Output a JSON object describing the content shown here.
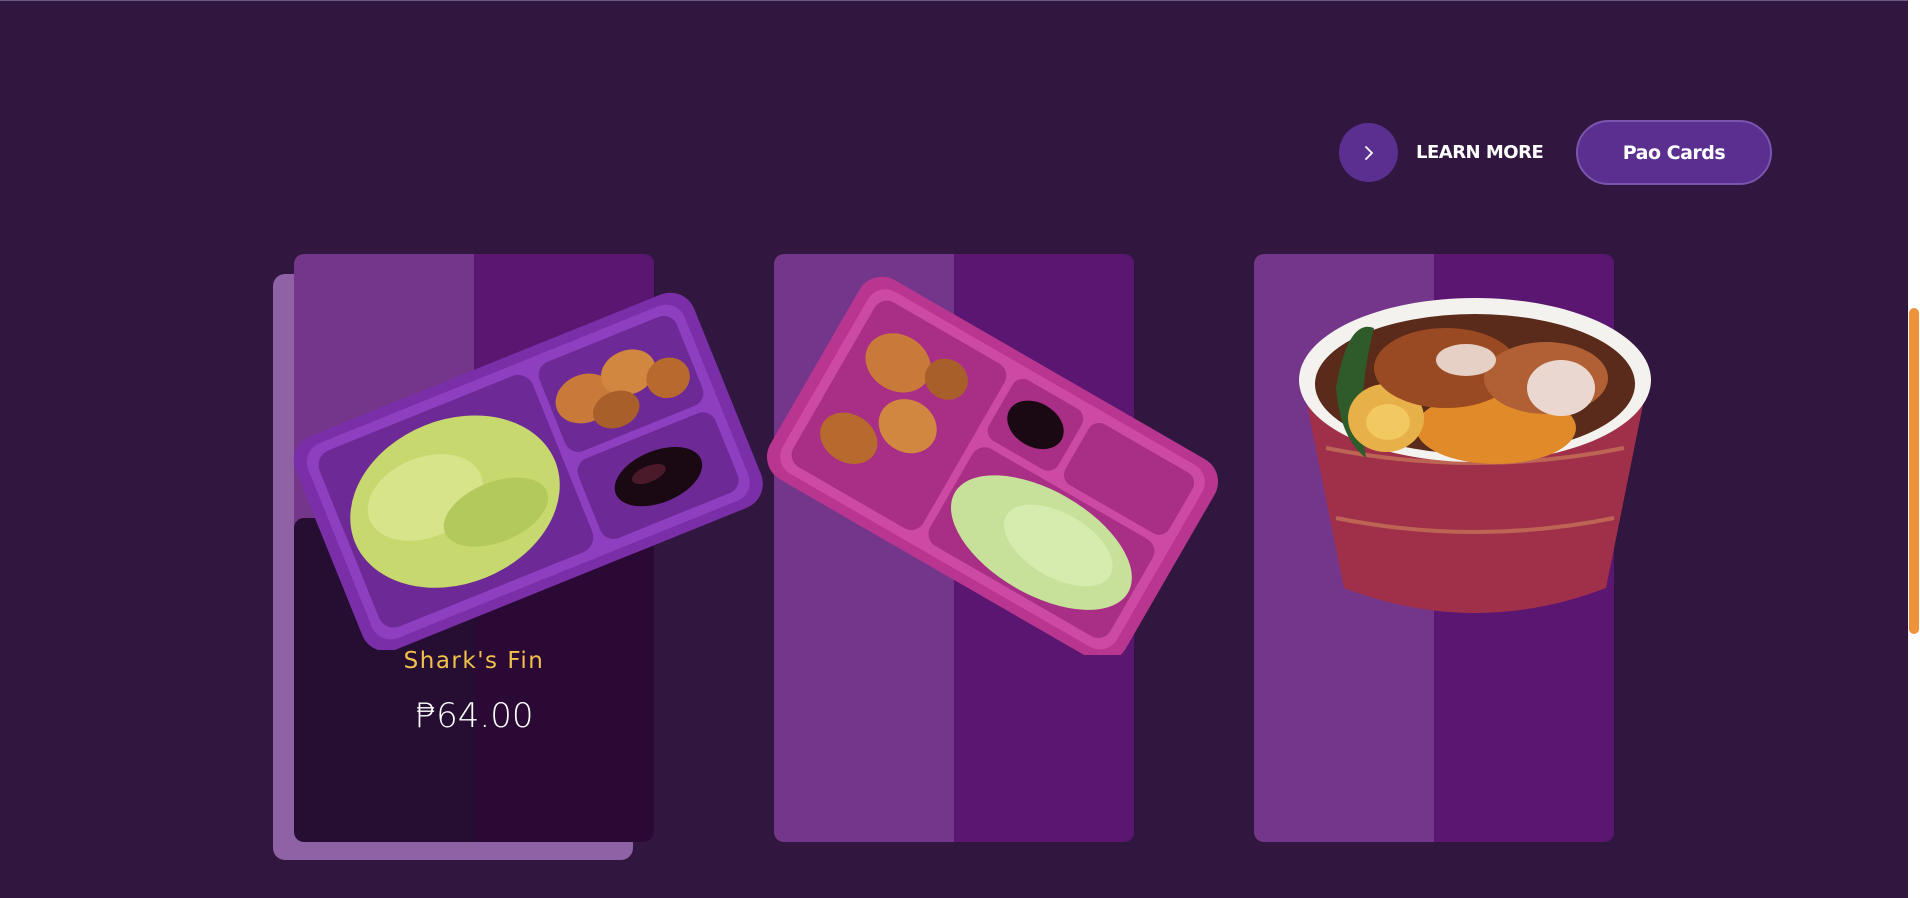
{
  "header": {
    "learn_more_label": "LEARN MORE",
    "pao_cards_label": "Pao Cards"
  },
  "products": [
    {
      "name": "Shark's Fin",
      "price": "₱64.00",
      "image": "sharks-fin-rice-box"
    },
    {
      "name": "",
      "price": "",
      "image": "dumplings-rice-box"
    },
    {
      "name": "",
      "price": "",
      "image": "pork-chop-noodle-bowl"
    }
  ],
  "colors": {
    "background": "#31163f",
    "card_left": "#74368a",
    "card_right": "#5b1672",
    "accent_purple": "#5b2f90",
    "name_yellow": "#f2c14b",
    "scroll_thumb": "#f0923a"
  }
}
